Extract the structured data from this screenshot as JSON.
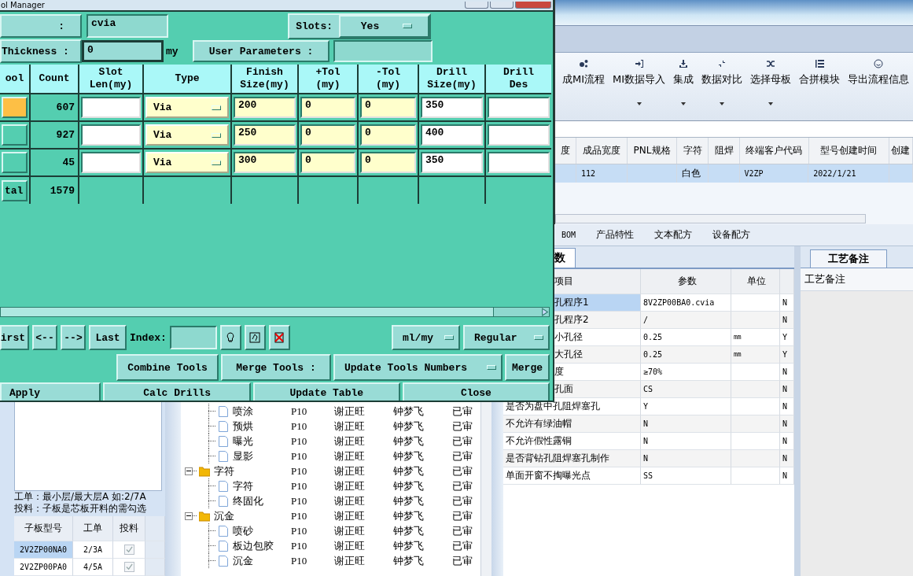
{
  "dialog": {
    "title": "ol Manager",
    "name_label": ":",
    "name_value": "cvia",
    "slots_label": "Slots:",
    "slots_value": "Yes",
    "thickness_label": "Thickness :",
    "thickness_value": "0",
    "thickness_unit": "my",
    "user_params_button": "User Parameters :",
    "columns": [
      "ool",
      "Count",
      "Slot Len(my)",
      "Type",
      "Finish Size(my)",
      "+Tol (my)",
      "-Tol (my)",
      "Drill Size(my)",
      "Drill Des"
    ],
    "tools": [
      {
        "selected": true,
        "count": "607",
        "type": "Via",
        "finish": "200",
        "plus_tol": "0",
        "minus_tol": "0",
        "drill_size": "350"
      },
      {
        "selected": false,
        "count": "927",
        "type": "Via",
        "finish": "250",
        "plus_tol": "0",
        "minus_tol": "0",
        "drill_size": "400"
      },
      {
        "selected": false,
        "count": "45",
        "type": "Via",
        "finish": "300",
        "plus_tol": "0",
        "minus_tol": "0",
        "drill_size": "350"
      }
    ],
    "total": {
      "label": "tal",
      "count": "1579"
    },
    "nav_buttons": [
      "irst",
      "<--",
      "-->",
      "Last"
    ],
    "index_label": "Index:",
    "units": "ml/my",
    "mode": "Regular",
    "combine_button": "Combine Tools",
    "merge_label": "Merge Tools :",
    "merge_mode": "Update Tools Numbers",
    "merge_button": "Merge",
    "actions": [
      "Apply",
      "Calc Drills",
      "Update Table",
      "Close"
    ]
  },
  "ribbon": [
    {
      "label": "成MI流程",
      "kind": "gears",
      "has_menu": false
    },
    {
      "label": "MI数据导入",
      "kind": "import",
      "has_menu": true
    },
    {
      "label": "集成",
      "kind": "download",
      "has_menu": true
    },
    {
      "label": "数据对比",
      "kind": "compress",
      "has_menu": true
    },
    {
      "label": "选择母板",
      "kind": "shuffle",
      "has_menu": true
    },
    {
      "label": "合拼模块",
      "kind": "list",
      "has_menu": false
    },
    {
      "label": "导出流程信息",
      "kind": "smile",
      "has_menu": false
    }
  ],
  "model_grid": {
    "columns": [
      "度",
      "成品宽度",
      "PNL规格",
      "字符",
      "阻焊",
      "终端客户代码",
      "型号创建时间",
      "创建"
    ],
    "rows": [
      {
        "selected": true,
        "cells": {
          "1": "112",
          "3": "白色",
          "5": "V2ZP",
          "6": "2022/1/21"
        }
      }
    ]
  },
  "detail_tabs": [
    "BOM",
    "产品特性",
    "文本配方",
    "设备配方"
  ],
  "params": {
    "tab": "数",
    "columns": [
      "项目",
      "参数",
      "单位"
    ],
    "rows": [
      {
        "item": "孔程序1",
        "value": "8V2ZP00BA0.cvia",
        "flag": "N",
        "selected": true
      },
      {
        "item": "孔程序2",
        "value": "/",
        "flag": "N",
        "selected": false
      },
      {
        "item": "小孔径",
        "value": "0.25",
        "unit": "mm",
        "flag": "Y",
        "selected": false
      },
      {
        "item": "大孔径",
        "value": "0.25",
        "unit": "mm",
        "flag": "Y",
        "selected": false
      },
      {
        "item": "度",
        "value": "≥70%",
        "flag": "N",
        "selected": false
      },
      {
        "item": "孔面",
        "value": "CS",
        "flag": "N",
        "selected": false
      },
      {
        "item": "是否为盘中孔阻焊塞孔",
        "value": "Y",
        "flag": "N",
        "selected": false
      },
      {
        "item": "不允许有绿油帽",
        "value": "N",
        "flag": "N",
        "selected": false
      },
      {
        "item": "不允许假性露铜",
        "value": "N",
        "flag": "N",
        "selected": false
      },
      {
        "item": "是否背钻孔阻焊塞孔制作",
        "value": "N",
        "flag": "N",
        "selected": false
      },
      {
        "item": "单面开窗不掏曝光点",
        "value": "SS",
        "flag": "N",
        "selected": false
      }
    ]
  },
  "remarks": {
    "tab": "工艺备注",
    "label": "工艺备注"
  },
  "tree": [
    {
      "name": "喷涂",
      "code": "P10",
      "maker": "谢正旺",
      "checker": "钟梦飞",
      "status": "已审"
    },
    {
      "name": "预烘",
      "code": "P10",
      "maker": "谢正旺",
      "checker": "钟梦飞",
      "status": "已审"
    },
    {
      "name": "曝光",
      "code": "P10",
      "maker": "谢正旺",
      "checker": "钟梦飞",
      "status": "已审"
    },
    {
      "name": "显影",
      "code": "P10",
      "maker": "谢正旺",
      "checker": "钟梦飞",
      "status": "已审"
    },
    {
      "name": "字符",
      "code": "P10",
      "maker": "谢正旺",
      "checker": "钟梦飞",
      "status": "已审",
      "expanded": true,
      "children": [
        {
          "name": "字符",
          "code": "P10",
          "maker": "谢正旺",
          "checker": "钟梦飞",
          "status": "已审"
        },
        {
          "name": "终固化",
          "code": "P10",
          "maker": "谢正旺",
          "checker": "钟梦飞",
          "status": "已审"
        }
      ]
    },
    {
      "name": "沉金",
      "code": "P10",
      "maker": "谢正旺",
      "checker": "钟梦飞",
      "status": "已审",
      "expanded": true,
      "children": [
        {
          "name": "喷砂",
          "code": "P10",
          "maker": "谢正旺",
          "checker": "钟梦飞",
          "status": "已审"
        },
        {
          "name": "板边包胶",
          "code": "P10",
          "maker": "谢正旺",
          "checker": "钟梦飞",
          "status": "已审"
        },
        {
          "name": "沉金",
          "code": "P10",
          "maker": "谢正旺",
          "checker": "钟梦飞",
          "status": "已审"
        }
      ]
    }
  ],
  "board_panel": {
    "notes": [
      "工单：最小层/最大层A 如:2/7A",
      "投料：子板是芯板开料的需勾选"
    ],
    "columns": [
      "子板型号",
      "工单",
      "投料"
    ],
    "rows": [
      {
        "model": "2V2ZP00NA0",
        "order": "2/3A",
        "fed": true,
        "selected": true
      },
      {
        "model": "2V2ZP00PA0",
        "order": "4/5A",
        "fed": true,
        "selected": false
      }
    ]
  }
}
